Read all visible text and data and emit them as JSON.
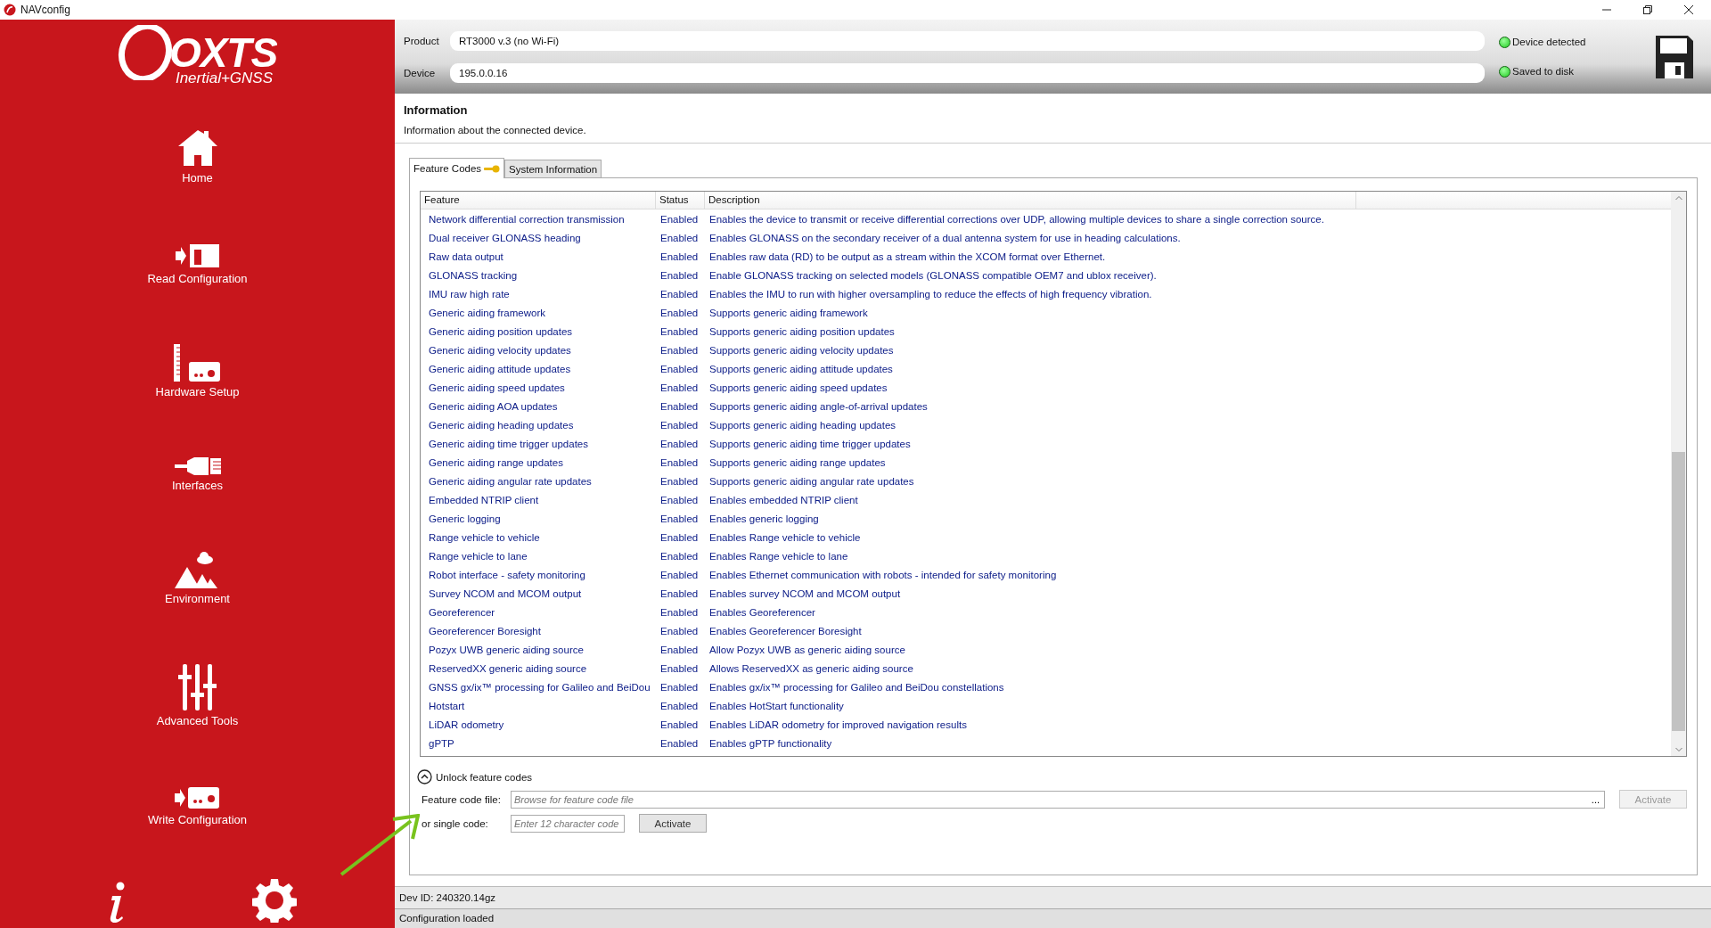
{
  "window": {
    "title": "NAVconfig"
  },
  "logo": {
    "brand": "OXTS",
    "tagline": "Inertial+GNSS"
  },
  "sidebar": {
    "items": [
      {
        "label": "Home",
        "kind": "home"
      },
      {
        "label": "Read Configuration",
        "kind": "read"
      },
      {
        "label": "Hardware Setup",
        "kind": "hardware"
      },
      {
        "label": "Interfaces",
        "kind": "interfaces"
      },
      {
        "label": "Environment",
        "kind": "environment"
      },
      {
        "label": "Advanced Tools",
        "kind": "advanced"
      },
      {
        "label": "Write Configuration",
        "kind": "write"
      }
    ]
  },
  "header": {
    "fields": [
      {
        "label": "Product",
        "value": "RT3000 v.3 (no Wi-Fi)"
      },
      {
        "label": "Device",
        "value": "195.0.0.16"
      }
    ],
    "indicators": [
      {
        "label": "Device detected",
        "on": true
      },
      {
        "label": "Saved to disk",
        "on": true
      }
    ]
  },
  "info": {
    "title": "Information",
    "description": "Information about the connected device."
  },
  "tabs": [
    {
      "label": "Feature Codes",
      "selected": true,
      "kind": "keyed"
    },
    {
      "label": "System Information",
      "selected": false
    }
  ],
  "table": {
    "columns": [
      "Feature",
      "Status",
      "Description"
    ],
    "rows": [
      {
        "feature": "Network differential correction transmission",
        "status": "Enabled",
        "description": "Enables the device to transmit or receive differential corrections over UDP, allowing multiple devices to share a single correction source."
      },
      {
        "feature": "Dual receiver GLONASS heading",
        "status": "Enabled",
        "description": "Enables GLONASS on the secondary receiver of a dual antenna system for use in heading calculations."
      },
      {
        "feature": "Raw data output",
        "status": "Enabled",
        "description": "Enables raw data (RD) to be output as a stream within the XCOM format over Ethernet."
      },
      {
        "feature": "GLONASS tracking",
        "status": "Enabled",
        "description": "Enable GLONASS tracking on selected models (GLONASS compatible OEM7 and ublox receiver)."
      },
      {
        "feature": "IMU raw high rate",
        "status": "Enabled",
        "description": "Enables the IMU to run with higher oversampling to reduce the effects of high frequency vibration."
      },
      {
        "feature": "Generic aiding framework",
        "status": "Enabled",
        "description": "Supports generic aiding framework"
      },
      {
        "feature": "Generic aiding position updates",
        "status": "Enabled",
        "description": "Supports generic aiding position updates"
      },
      {
        "feature": "Generic aiding velocity updates",
        "status": "Enabled",
        "description": "Supports generic aiding velocity updates"
      },
      {
        "feature": "Generic aiding attitude updates",
        "status": "Enabled",
        "description": "Supports generic aiding attitude updates"
      },
      {
        "feature": "Generic aiding speed updates",
        "status": "Enabled",
        "description": "Supports generic aiding speed updates"
      },
      {
        "feature": "Generic aiding AOA updates",
        "status": "Enabled",
        "description": "Supports generic aiding angle-of-arrival updates"
      },
      {
        "feature": "Generic aiding heading updates",
        "status": "Enabled",
        "description": "Supports generic aiding heading updates"
      },
      {
        "feature": "Generic aiding time trigger updates",
        "status": "Enabled",
        "description": "Supports generic aiding time trigger updates"
      },
      {
        "feature": "Generic aiding range updates",
        "status": "Enabled",
        "description": "Supports generic aiding range updates"
      },
      {
        "feature": "Generic aiding angular rate updates",
        "status": "Enabled",
        "description": "Supports generic aiding angular rate updates"
      },
      {
        "feature": "Embedded NTRIP client",
        "status": "Enabled",
        "description": "Enables embedded NTRIP client"
      },
      {
        "feature": "Generic logging",
        "status": "Enabled",
        "description": "Enables generic logging"
      },
      {
        "feature": "Range vehicle to vehicle",
        "status": "Enabled",
        "description": "Enables Range vehicle to vehicle"
      },
      {
        "feature": "Range vehicle to lane",
        "status": "Enabled",
        "description": "Enables Range vehicle to lane"
      },
      {
        "feature": "Robot interface - safety monitoring",
        "status": "Enabled",
        "description": "Enables Ethernet communication with robots - intended for safety monitoring"
      },
      {
        "feature": "Survey NCOM and MCOM output",
        "status": "Enabled",
        "description": "Enables survey NCOM and MCOM output"
      },
      {
        "feature": "Georeferencer",
        "status": "Enabled",
        "description": "Enables Georeferencer"
      },
      {
        "feature": "Georeferencer Boresight",
        "status": "Enabled",
        "description": "Enables Georeferencer Boresight"
      },
      {
        "feature": "Pozyx UWB generic aiding source",
        "status": "Enabled",
        "description": "Allow Pozyx UWB as generic aiding source"
      },
      {
        "feature": "ReservedXX generic aiding source",
        "status": "Enabled",
        "description": "Allows ReservedXX as generic aiding source"
      },
      {
        "feature": "GNSS gx/ix™ processing for Galileo and BeiDou",
        "status": "Enabled",
        "description": "Enables gx/ix™ processing for Galileo and BeiDou constellations"
      },
      {
        "feature": "Hotstart",
        "status": "Enabled",
        "description": "Enables HotStart functionality"
      },
      {
        "feature": "LiDAR odometry",
        "status": "Enabled",
        "description": "Enables LiDAR odometry for improved navigation results"
      },
      {
        "feature": "gPTP",
        "status": "Enabled",
        "description": "Enables gPTP functionality"
      }
    ]
  },
  "unlock": {
    "label": "Unlock feature codes",
    "expanded": true,
    "file": {
      "label": "Feature code file:",
      "placeholder": "Browse for feature code file",
      "browse": "...",
      "button": "Activate",
      "disabled": true
    },
    "single": {
      "label": "or single code:",
      "placeholder": "Enter 12 character code",
      "button": "Activate",
      "disabled": false
    }
  },
  "status_bar": {
    "dev_id": "Dev ID: 240320.14gz",
    "status": "Configuration loaded"
  }
}
